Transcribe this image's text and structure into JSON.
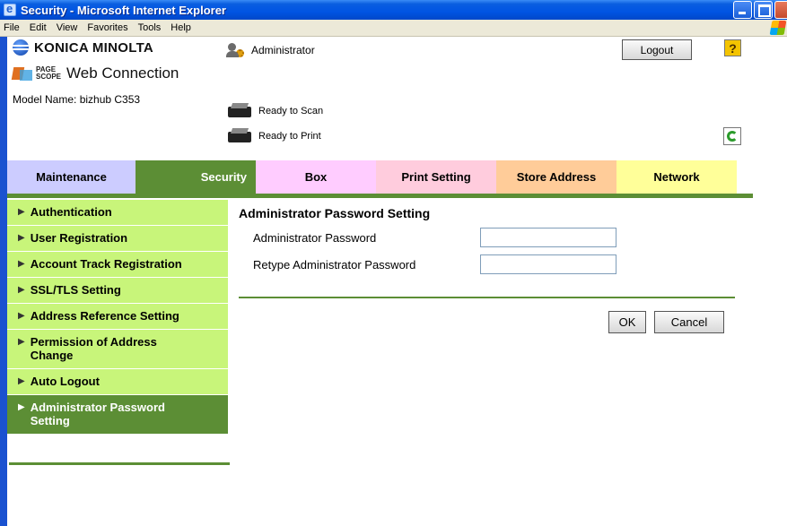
{
  "window": {
    "title": "Security - Microsoft Internet Explorer"
  },
  "menubar": {
    "items": [
      "File",
      "Edit",
      "View",
      "Favorites",
      "Tools",
      "Help"
    ]
  },
  "header": {
    "brand": "KONICA MINOLTA",
    "product_small_top": "PAGE",
    "product_small_bottom": "SCOPE",
    "product": "Web Connection",
    "model_name": "Model Name: bizhub C353",
    "user": "Administrator",
    "logout_label": "Logout",
    "help_label": "?",
    "status_scan": "Ready to Scan",
    "status_print": "Ready to Print"
  },
  "tabs": [
    {
      "label": "Maintenance",
      "color": "#ccccff",
      "text_color": "#000000"
    },
    {
      "label": "Security",
      "color": "#5c8e35",
      "text_color": "#ffffff",
      "active": true
    },
    {
      "label": "Box",
      "color": "#ffccff",
      "text_color": "#000000"
    },
    {
      "label": "Print Setting",
      "color": "#ffccdd",
      "text_color": "#000000"
    },
    {
      "label": "Store Address",
      "color": "#ffcc99",
      "text_color": "#000000"
    },
    {
      "label": "Network",
      "color": "#ffff99",
      "text_color": "#000000"
    }
  ],
  "sidebar": {
    "items": [
      {
        "label": "Authentication"
      },
      {
        "label": "User Registration"
      },
      {
        "label": "Account Track Registration"
      },
      {
        "label": "SSL/TLS Setting"
      },
      {
        "label": "Address Reference Setting"
      },
      {
        "label": "Permission of Address Change"
      },
      {
        "label": "Auto Logout"
      },
      {
        "label": "Administrator Password Setting",
        "active": true
      }
    ]
  },
  "main": {
    "title": "Administrator Password Setting",
    "fields": [
      {
        "label": "Administrator Password",
        "value": ""
      },
      {
        "label": "Retype Administrator Password",
        "value": ""
      }
    ],
    "ok_label": "OK",
    "cancel_label": "Cancel"
  },
  "colors": {
    "accent_green": "#5c8e35",
    "nav_green": "#c8f57a",
    "xp_blue": "#0054e3"
  }
}
